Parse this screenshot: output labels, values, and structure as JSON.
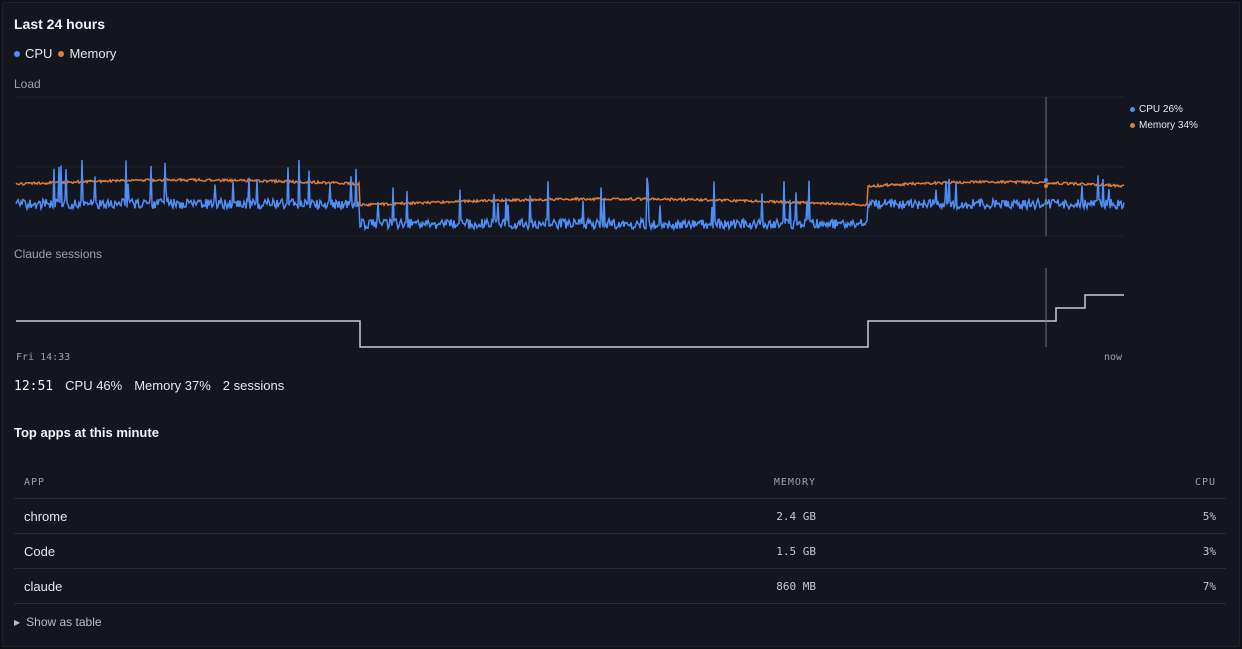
{
  "header": {
    "title": "Last 24 hours"
  },
  "legend": {
    "items": [
      {
        "label": "CPU",
        "color": "#4f8ef7"
      },
      {
        "label": "Memory",
        "color": "#e07b39"
      }
    ]
  },
  "sections": {
    "load_label": "Load",
    "sessions_label": "Claude sessions"
  },
  "axis": {
    "start_label": "Fri 14:33",
    "end_label": "now"
  },
  "hover": {
    "cpu_label": "CPU 26%",
    "memory_label": "Memory 34%"
  },
  "readout": {
    "time": "12:51",
    "cpu": "CPU 46%",
    "memory": "Memory 37%",
    "sessions": "2 sessions"
  },
  "top_apps": {
    "title": "Top apps at this minute",
    "columns": [
      "APP",
      "MEMORY",
      "CPU"
    ],
    "rows": [
      {
        "app": "chrome",
        "memory": "2.4 GB",
        "cpu": "5%"
      },
      {
        "app": "Code",
        "memory": "1.5 GB",
        "cpu": "3%"
      },
      {
        "app": "claude",
        "memory": "860 MB",
        "cpu": "7%"
      }
    ]
  },
  "toggle": {
    "label": "Show as table"
  },
  "colors": {
    "cpu": "#4f8ef7",
    "memory": "#e07b39",
    "sessions": "#c9ccd4",
    "cursor": "#6b7080"
  }
}
